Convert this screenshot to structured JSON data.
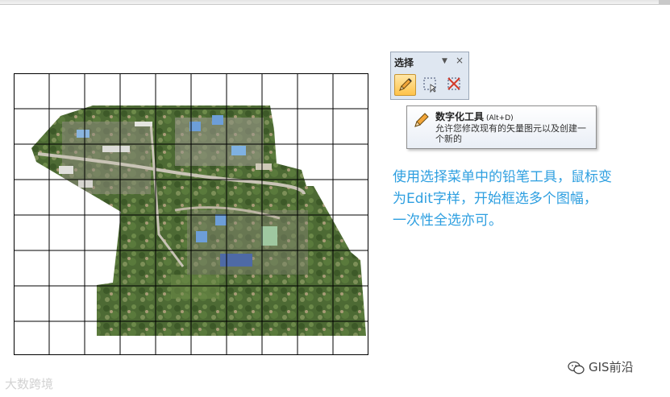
{
  "toolbar": {
    "title": "选择",
    "dropdown_glyph": "▼",
    "close_glyph": "×",
    "tools": [
      {
        "name": "pencil-tool",
        "icon": "pencil-icon",
        "active": true
      },
      {
        "name": "select-rect-tool",
        "icon": "dashed-rect-icon",
        "active": false
      },
      {
        "name": "clear-selection-tool",
        "icon": "clear-selection-icon",
        "active": false
      }
    ]
  },
  "tooltip": {
    "title": "数字化工具",
    "shortcut": "(Alt+D)",
    "description": "允许您修改现有的矢量图元以及创建一个新的"
  },
  "annotation": {
    "lines": [
      "使用选择菜单中的铅笔工具，鼠标变",
      "为Edit字样，开始框选多个图幅，",
      "一次性全选亦可。"
    ],
    "color": "#2e9fe0"
  },
  "watermarks": {
    "left": "大数跨境",
    "right": "GIS前沿"
  },
  "map": {
    "grid_columns": 10,
    "grid_rows": 8,
    "line_color": "#000000"
  }
}
